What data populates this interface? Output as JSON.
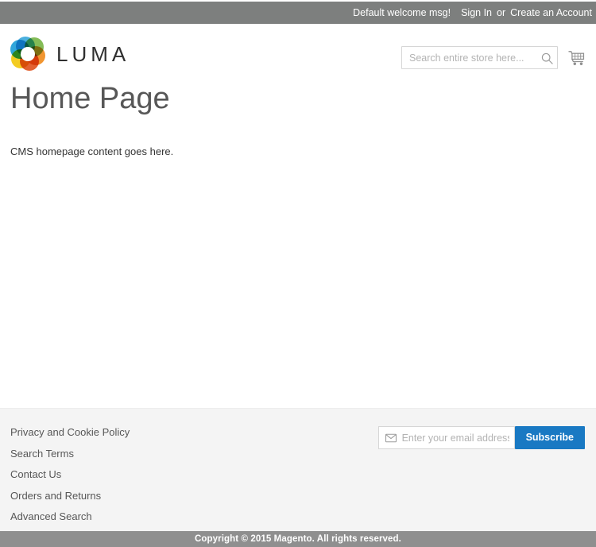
{
  "top_panel": {
    "welcome_message": "Default welcome msg!",
    "sign_in_label": "Sign In",
    "separator": "or",
    "create_account_label": "Create an Account"
  },
  "header": {
    "logo_text": "LUMA",
    "logo_colors": {
      "blue": "#1f9fd8",
      "light_blue": "#3ba9dd",
      "green": "#7ab648",
      "orange": "#f08c1e",
      "red_orange": "#e0541f",
      "yellow": "#f2c80f"
    },
    "search": {
      "placeholder": "Search entire store here...",
      "value": "",
      "icon": "search-icon"
    },
    "cart": {
      "icon": "shopping-cart-icon",
      "count": ""
    }
  },
  "main": {
    "page_title": "Home Page",
    "content": "CMS homepage content goes here."
  },
  "footer": {
    "links": [
      {
        "label": "Privacy and Cookie Policy"
      },
      {
        "label": "Search Terms"
      },
      {
        "label": "Contact Us"
      },
      {
        "label": "Orders and Returns"
      },
      {
        "label": "Advanced Search"
      }
    ],
    "newsletter": {
      "icon": "envelope-icon",
      "placeholder": "Enter your email address",
      "value": "",
      "subscribe_label": "Subscribe",
      "subscribe_color": "#1979c3"
    }
  },
  "copyright": {
    "text": "Copyright © 2015 Magento. All rights reserved.",
    "background": "#8f8f8f"
  }
}
